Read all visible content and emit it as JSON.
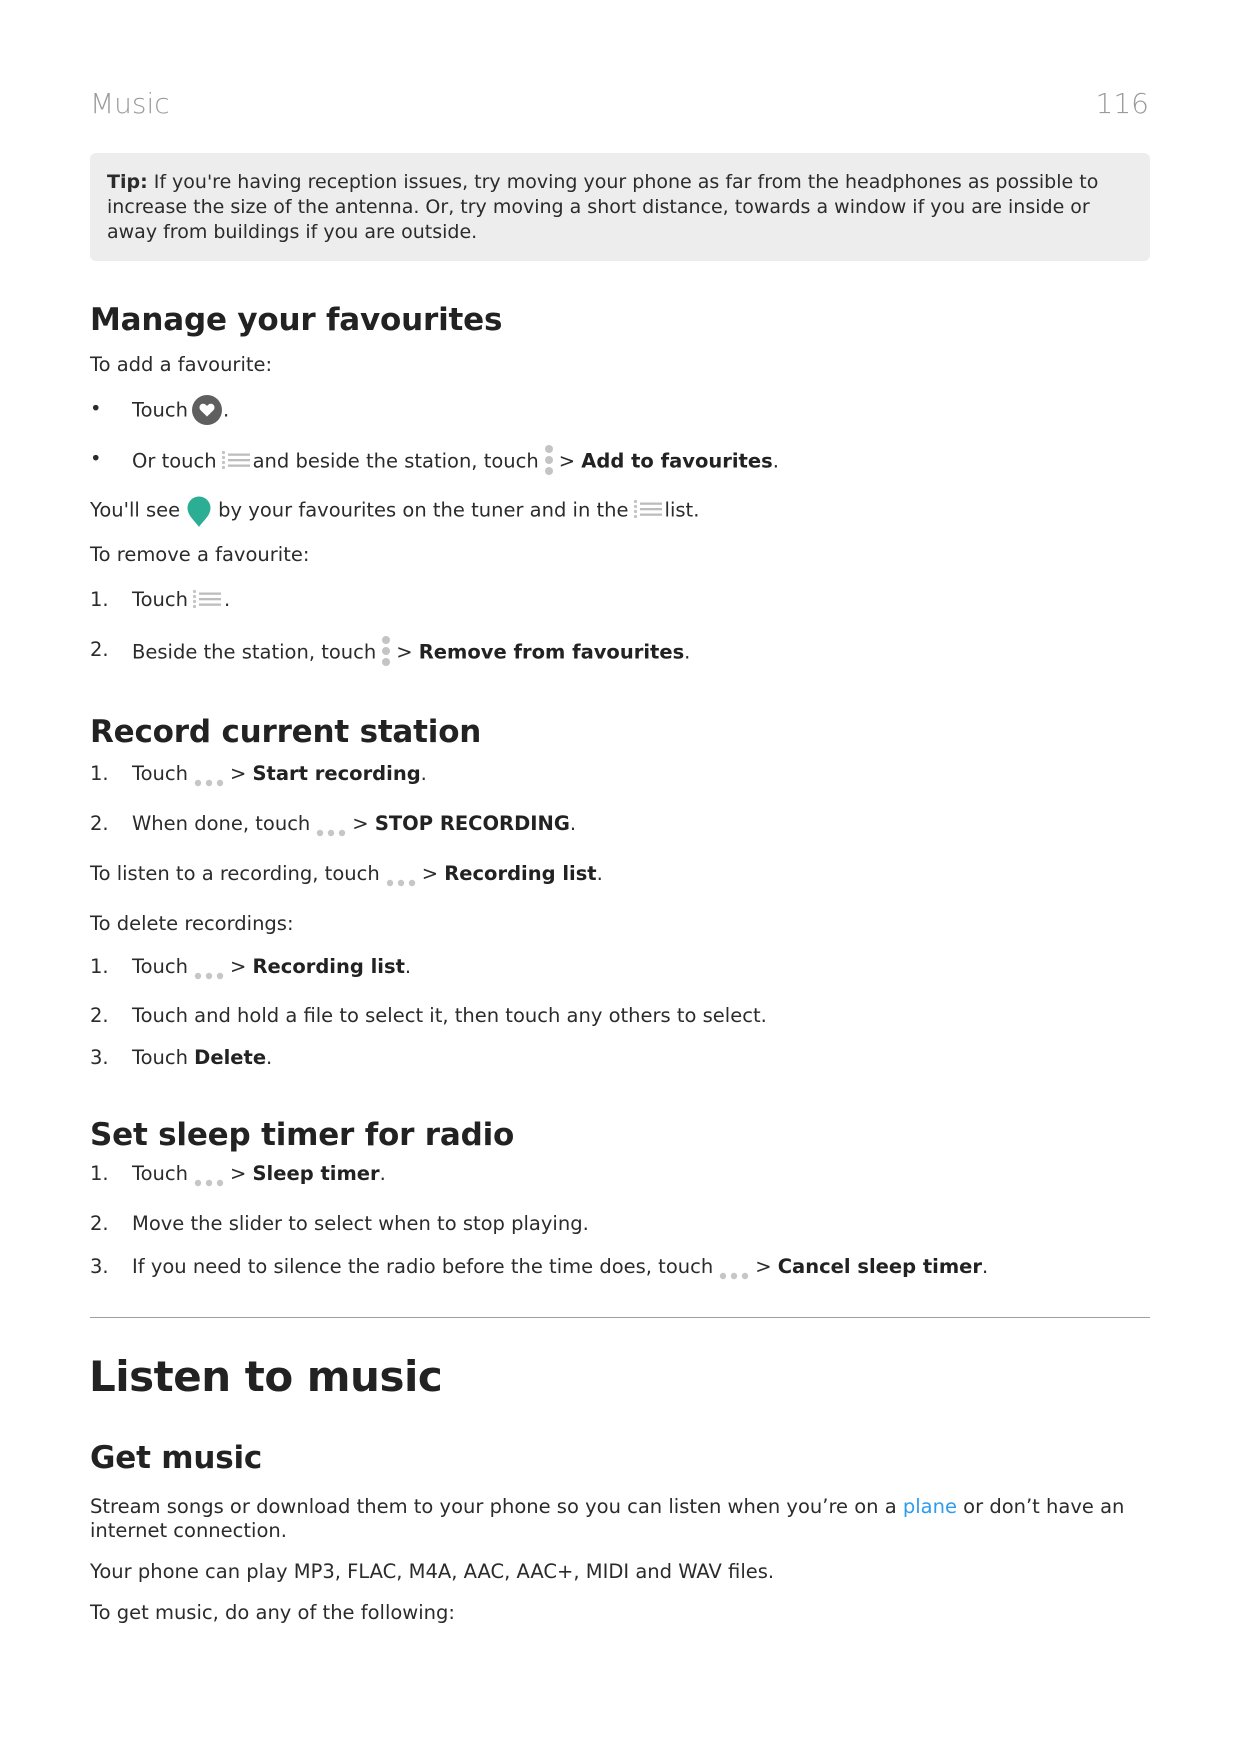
{
  "header": {
    "section_title": "Music",
    "page_number": "116"
  },
  "tip": {
    "label": "Tip:",
    "text": " If you're having reception issues, try moving your phone as far from the headphones as possible to increase the size of the antenna. Or, try moving a short distance, towards a window if you are inside or away from buildings if you are outside."
  },
  "icons": {
    "favourite": "heart-circle-icon",
    "list": "list-icon",
    "more_vertical": "more-vertical-icon",
    "more_horizontal": "more-horizontal-icon",
    "favourite_marker": "location-pin-icon"
  },
  "colors": {
    "pin": "#2bae94",
    "link": "#2d9cf0",
    "icon_gray": "#bdbdbd",
    "heart_bg": "#5f5f5f",
    "tip_bg": "#ededed"
  },
  "favourites": {
    "heading": "Manage your favourites",
    "add_intro": "To add a favourite:",
    "bullet_marker": "•",
    "add_steps": [
      {
        "pre": "Touch",
        "post": "."
      },
      {
        "pre": "Or touch",
        "mid": "and beside the station, touch",
        "sep": ">",
        "bold": "Add to favourites",
        "post": "."
      }
    ],
    "see_pre": "You'll see",
    "see_post": "by your favourites on the tuner and in the",
    "see_end": "list.",
    "remove_intro": "To remove a favourite:",
    "remove_steps": [
      {
        "num": "1.",
        "pre": "Touch",
        "post": "."
      },
      {
        "num": "2.",
        "pre": "Beside the station, touch",
        "sep": ">",
        "bold": "Remove from favourites",
        "post": "."
      }
    ]
  },
  "record": {
    "heading": "Record current station",
    "steps": [
      {
        "num": "1.",
        "pre": "Touch",
        "sep": ">",
        "bold": "Start recording",
        "post": "."
      },
      {
        "num": "2.",
        "pre": "When done, touch",
        "sep": ">",
        "bold": "STOP RECORDING",
        "post": "."
      }
    ],
    "listen_pre": "To listen to a recording, touch",
    "listen_sep": ">",
    "listen_bold": "Recording list",
    "listen_post": ".",
    "delete_intro": "To delete recordings:",
    "delete_steps": [
      {
        "num": "1.",
        "pre": "Touch",
        "sep": ">",
        "bold": "Recording list",
        "post": "."
      },
      {
        "num": "2.",
        "text": "Touch and hold a file to select it, then touch any others to select."
      },
      {
        "num": "3.",
        "pre": "Touch ",
        "bold": "Delete",
        "post": "."
      }
    ]
  },
  "sleep": {
    "heading": "Set sleep timer for radio",
    "steps": [
      {
        "num": "1.",
        "pre": "Touch",
        "sep": ">",
        "bold": "Sleep timer",
        "post": "."
      },
      {
        "num": "2.",
        "text": "Move the slider to select when to stop playing."
      },
      {
        "num": "3.",
        "pre": "If you need to silence the radio before the time does, touch",
        "sep": ">",
        "bold": "Cancel sleep timer",
        "post": "."
      }
    ]
  },
  "listen": {
    "title": "Listen to music",
    "get_heading": "Get music",
    "stream_pre": "Stream songs or download them to your phone so you can listen when you’re on a ",
    "stream_link": "plane",
    "stream_post": " or don’t have an",
    "stream_line2": "internet connection.",
    "formats": "Your phone can play MP3, FLAC, M4A, AAC, AAC+, MIDI and WAV files.",
    "get_intro": "To get music, do any of the following:"
  }
}
